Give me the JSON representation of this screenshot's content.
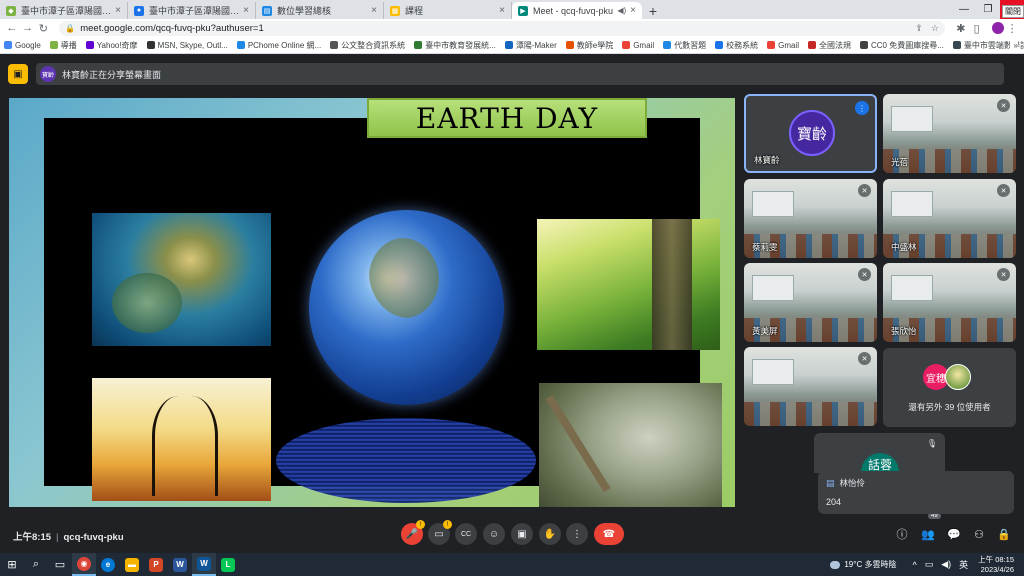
{
  "browser": {
    "tabs": [
      {
        "label": "臺中市潭子區潭陽國民小學",
        "favicon_color": "#7cb342",
        "active": false
      },
      {
        "label": "臺中市潭子區潭陽國小校務系統",
        "favicon_color": "#1a73e8",
        "active": false
      },
      {
        "label": "數位學習總核",
        "favicon_color": "#1e88e5",
        "active": false
      },
      {
        "label": "課程",
        "favicon_color": "#fbbc04",
        "active": false
      },
      {
        "label": "Meet - qcq-fuvq-pku",
        "favicon_color": "#00897b",
        "active": true
      }
    ],
    "new_tab": "+",
    "window_controls": {
      "minimize": "—",
      "restore": "❐",
      "close": "✕"
    },
    "tooltip": "關閉",
    "url": "meet.google.com/qcq-fuvq-pku?authuser=1",
    "bookmarks": [
      {
        "label": "Google",
        "color": "#4285f4"
      },
      {
        "label": "導播",
        "color": "#7cb342"
      },
      {
        "label": "Yahoo!奇摩",
        "color": "#6001d2"
      },
      {
        "label": "MSN, Skype, Outl...",
        "color": "#333333"
      },
      {
        "label": "PChome Online 網...",
        "color": "#1e88e5"
      },
      {
        "label": "公文整合資訊系統",
        "color": "#555555"
      },
      {
        "label": "臺中市教育發展統...",
        "color": "#2e7d32"
      },
      {
        "label": "潭陽-Maker",
        "color": "#1565c0"
      },
      {
        "label": "教師e學院",
        "color": "#e65100"
      },
      {
        "label": "Gmail",
        "color": "#ea4335"
      },
      {
        "label": "代數習題",
        "color": "#1e88e5"
      },
      {
        "label": "校務系統",
        "color": "#1a73e8"
      },
      {
        "label": "Gmail",
        "color": "#ea4335"
      },
      {
        "label": "全國法規",
        "color": "#c62828"
      },
      {
        "label": "CC0 免費圖庫搜尋...",
        "color": "#424242"
      },
      {
        "label": "臺中市雲端數學計...",
        "color": "#37474f"
      },
      {
        "label": "Word轉JPG",
        "color": "#d32f2f"
      }
    ],
    "bookmarks_more": "»"
  },
  "meet": {
    "presenting_text": "林寶齡正在分享螢幕畫面",
    "presenter_avatar": "寶齡",
    "slide": {
      "title": "EARTH DAY"
    },
    "participants": [
      {
        "name": "林寶齡",
        "avatar": "寶齡",
        "type": "avatar"
      },
      {
        "name": "光蓓",
        "type": "classroom"
      },
      {
        "name": "蔡莉雯",
        "type": "classroom"
      },
      {
        "name": "中盛林",
        "type": "classroom"
      },
      {
        "name": "黃美屏",
        "type": "classroom"
      },
      {
        "name": "張欣怡",
        "type": "classroom"
      },
      {
        "name": "",
        "type": "classroom"
      }
    ],
    "others": {
      "avatar_letters": "宜穗",
      "text": "還有另外 39 位使用者"
    },
    "partial_tile_avatar": "話蓉",
    "chat_toast": {
      "sender": "林怡伶",
      "message": "204"
    },
    "meeting_time": "上午8:15",
    "meeting_code": "qcq-fuvq-pku",
    "people_count": "49",
    "icons": {
      "more": "⋮",
      "mic_off": "🎤",
      "mic": "🎙",
      "camera": "▭",
      "captions": "CC",
      "emoji": "☺",
      "present": "▣",
      "hand": "✋",
      "hangup": "☎",
      "info": "ⓘ",
      "people": "👥",
      "chat": "💬",
      "activities": "⚇",
      "lock": "🔒"
    }
  },
  "taskbar": {
    "weather": "19°C 多雲時陰",
    "ime": "英",
    "clock_time": "上午 08:15",
    "clock_date": "2023/4/26",
    "apps": [
      {
        "name": "search",
        "glyph": "⌕",
        "color": "transparent"
      },
      {
        "name": "task-view",
        "glyph": "▭",
        "color": "transparent"
      },
      {
        "name": "chrome",
        "glyph": "◉",
        "color": "#db4437"
      },
      {
        "name": "edge",
        "glyph": "e",
        "color": "#0078d4"
      },
      {
        "name": "explorer",
        "glyph": "▬",
        "color": "#f4b400"
      },
      {
        "name": "powerpoint",
        "glyph": "P",
        "color": "#d24726"
      },
      {
        "name": "word",
        "glyph": "W",
        "color": "#2b579a"
      },
      {
        "name": "whiteboard",
        "glyph": "W",
        "color": "#0f5496"
      },
      {
        "name": "line",
        "glyph": "L",
        "color": "#06c755"
      }
    ]
  }
}
